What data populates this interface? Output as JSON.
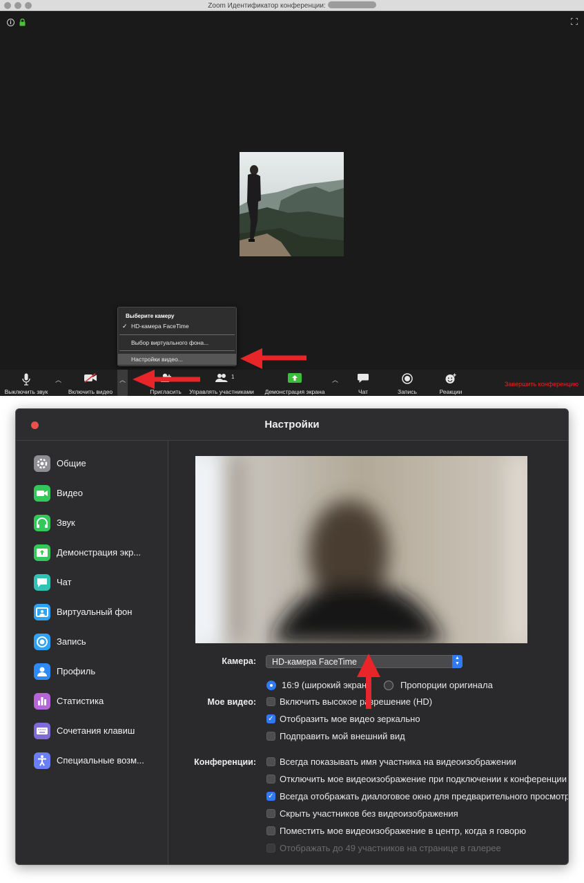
{
  "meeting": {
    "window_title": "Zoom Идентификатор конференции:",
    "camera_menu": {
      "header": "Выберите камеру",
      "selected_camera": "HD-камера FaceTime",
      "virtual_bg": "Выбор виртуального фона...",
      "video_settings": "Настройки видео..."
    },
    "toolbar": {
      "mute": "Выключить звук",
      "start_video": "Включить видео",
      "invite": "Пригласить",
      "participants": "Управлять участниками",
      "participants_count": "1",
      "share": "Демонстрация экрана",
      "chat": "Чат",
      "record": "Запись",
      "reactions": "Реакции",
      "end": "Завершить конференцию"
    }
  },
  "settings": {
    "title": "Настройки",
    "sidebar": [
      {
        "label": "Общие",
        "icon": "gear-icon",
        "color": "#8e8e93"
      },
      {
        "label": "Видео",
        "icon": "video-icon",
        "color": "#34c759"
      },
      {
        "label": "Звук",
        "icon": "headphones-icon",
        "color": "#34c759"
      },
      {
        "label": "Демонстрация экр...",
        "icon": "share-screen-icon",
        "color": "#34c759"
      },
      {
        "label": "Чат",
        "icon": "chat-icon",
        "color": "#30c2b4"
      },
      {
        "label": "Виртуальный фон",
        "icon": "virtual-bg-icon",
        "color": "#2fa2f5"
      },
      {
        "label": "Запись",
        "icon": "record-icon",
        "color": "#2fa2f5"
      },
      {
        "label": "Профиль",
        "icon": "profile-icon",
        "color": "#2f8af5"
      },
      {
        "label": "Статистика",
        "icon": "statistics-icon",
        "color": "#b565d8"
      },
      {
        "label": "Сочетания клавиш",
        "icon": "keyboard-icon",
        "color": "#7e6bd8"
      },
      {
        "label": "Специальные возм...",
        "icon": "accessibility-icon",
        "color": "#6a7ff5"
      }
    ],
    "camera_label": "Камера:",
    "camera_value": "HD-камера FaceTime",
    "my_video_label": "Мое видео:",
    "ratio_wide": "16:9 (широкий экран)",
    "ratio_original": "Пропорции оригинала",
    "hd": "Включить высокое разрешение (HD)",
    "mirror": "Отобразить мое видео зеркально",
    "touch_up": "Подправить мой внешний вид",
    "meetings_label": "Конференции:",
    "meeting_opts": [
      {
        "label": "Всегда показывать имя участника на видеоизображении",
        "checked": false
      },
      {
        "label": "Отключить мое видеоизображение при подключении к конференции",
        "checked": false
      },
      {
        "label": "Всегда отображать диалоговое окно для предварительного просмотра видео",
        "checked": true
      },
      {
        "label": "Скрыть участников без видеоизображения",
        "checked": false
      },
      {
        "label": "Поместить мое видеоизображение в центр, когда я говорю",
        "checked": false
      },
      {
        "label": "Отображать до 49 участников на странице в галерее",
        "checked": false,
        "disabled": true
      }
    ]
  }
}
